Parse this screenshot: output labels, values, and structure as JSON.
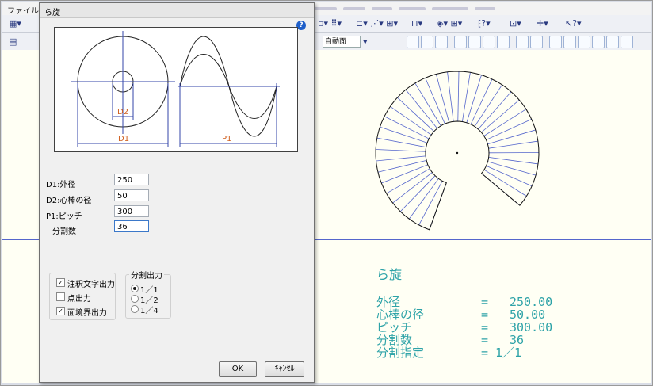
{
  "menu": {
    "file": "ファイル"
  },
  "toolbar": {
    "view_mode": "自動面"
  },
  "note": {
    "title": "ら旋",
    "rows": [
      {
        "label": "外径",
        "eq": "=",
        "value": "250.00"
      },
      {
        "label": "心棒の径",
        "eq": "=",
        "value": "50.00"
      },
      {
        "label": "ピッチ",
        "eq": "=",
        "value": "300.00"
      },
      {
        "label": "分割数",
        "eq": "=",
        "value": "36"
      },
      {
        "label": "分割指定",
        "eq": "=",
        "value": "1／1"
      }
    ]
  },
  "dialog": {
    "title": "ら旋",
    "help": "?",
    "preview": {
      "d2": "D2",
      "d1": "D1",
      "p1": "P1"
    },
    "fields": [
      {
        "label": "D1:外径",
        "value": "250"
      },
      {
        "label": "D2:心棒の径",
        "value": "50"
      },
      {
        "label": "P1:ピッチ",
        "value": "300"
      },
      {
        "label": "分割数",
        "value": "36"
      }
    ],
    "checkboxes": [
      {
        "label": "注釈文字出力",
        "checked": true
      },
      {
        "label": "点出力",
        "checked": false
      },
      {
        "label": "面境界出力",
        "checked": true
      }
    ],
    "radio_group": {
      "title": "分割出力",
      "options": [
        {
          "label": "1／1",
          "selected": true
        },
        {
          "label": "1／2",
          "selected": false
        },
        {
          "label": "1／4",
          "selected": false
        }
      ]
    },
    "ok": "OK",
    "cancel": "ｷｬﾝｾﾙ"
  },
  "colors": {
    "accent_line": "#5566cc",
    "note_text": "#2ea3a8",
    "help_icon": "#1f5fc9"
  }
}
